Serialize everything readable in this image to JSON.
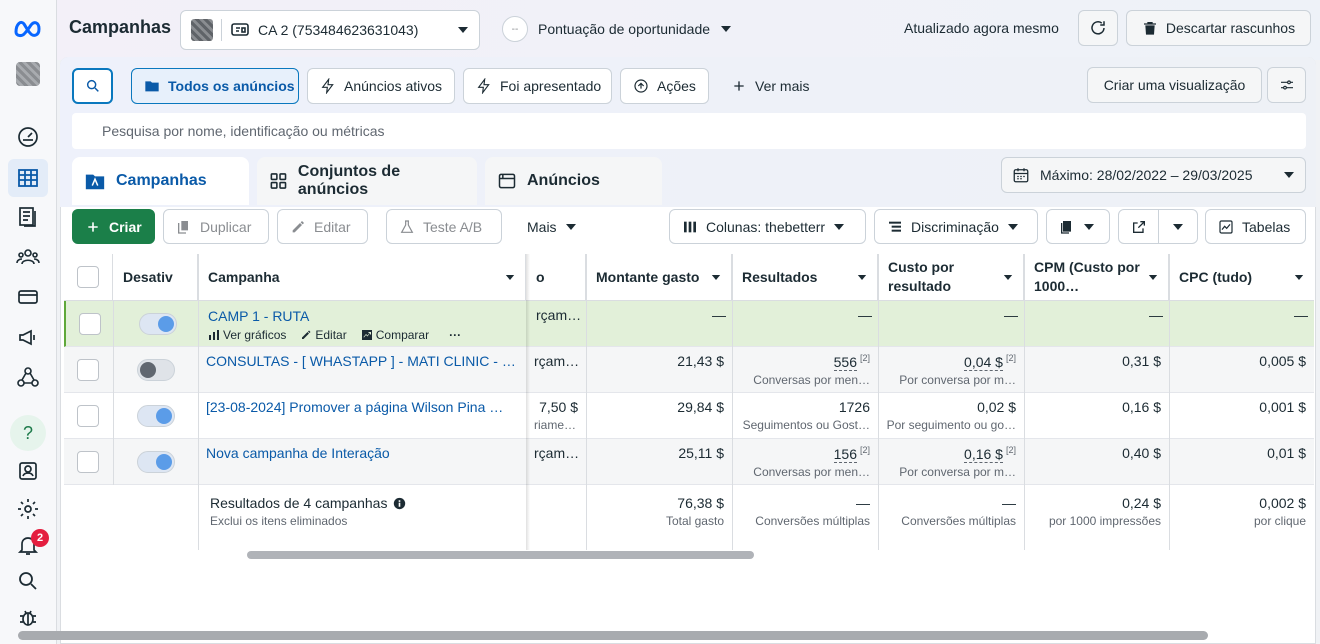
{
  "header": {
    "title": "Campanhas",
    "account_name": "CA 2 (753484623631043)",
    "opportunity_label": "Pontuação de oportunidade",
    "opportunity_dots": "--",
    "updated_label": "Atualizado agora mesmo",
    "discard_label": "Descartar rascunhos"
  },
  "rail": {
    "notification_count": "2",
    "help_glyph": "?"
  },
  "filters": {
    "all_ads": "Todos os anúncios",
    "active_ads": "Anúncios ativos",
    "presented": "Foi apresentado",
    "actions": "Ações",
    "see_more": "Ver mais",
    "create_view": "Criar uma visualização",
    "search_placeholder": "Pesquisa por nome, identificação ou métricas"
  },
  "tabs": [
    {
      "label": "Campanhas"
    },
    {
      "label": "Conjuntos de anúncios"
    },
    {
      "label": "Anúncios"
    }
  ],
  "date_range": "Máximo: 28/02/2022 – 29/03/2025",
  "toolbar": {
    "create": "Criar",
    "duplicate": "Duplicar",
    "edit": "Editar",
    "ab_test": "Teste A/B",
    "more": "Mais",
    "columns": "Colunas: thebetterr",
    "breakdown": "Discriminação",
    "tables": "Tabelas"
  },
  "table": {
    "headers": {
      "off": "Desativ",
      "campaign": "Campanha",
      "budget_partial": "o",
      "spent": "Montante gasto",
      "results": "Resultados",
      "cost_per_result": "Custo por resultado",
      "cpm": "CPM (Custo por 1000…",
      "cpc": "CPC (tudo)"
    },
    "row_actions": {
      "charts": "Ver gráficos",
      "edit": "Editar",
      "compare": "Comparar",
      "more": "···"
    },
    "rows": [
      {
        "name": "CAMP 1 - RUTA",
        "budget": "rçam…",
        "budget_sub": "",
        "spent": "—",
        "results": "—",
        "results_sub": "",
        "results_sup": "",
        "cpr": "—",
        "cpr_sub": "",
        "cpr_sup": "",
        "cpm": "—",
        "cpc": "—"
      },
      {
        "name": "CONSULTAS - [ WHASTAPP ] - MATI CLINIC - …",
        "budget": "rçam…",
        "budget_sub": "",
        "spent": "21,43 $",
        "results": "556",
        "results_sub": "Conversas por men…",
        "results_sup": "[2]",
        "cpr": "0,04 $",
        "cpr_sub": "Por conversa por m…",
        "cpr_sup": "[2]",
        "cpm": "0,31 $",
        "cpc": "0,005 $"
      },
      {
        "name": "[23-08-2024] Promover a página Wilson Pina …",
        "budget": "7,50 $",
        "budget_sub": "riamente",
        "spent": "29,84 $",
        "results": "1726",
        "results_sub": "Seguimentos ou Gost…",
        "results_sup": "",
        "cpr": "0,02 $",
        "cpr_sub": "Por seguimento ou go…",
        "cpr_sup": "",
        "cpm": "0,16 $",
        "cpc": "0,001 $"
      },
      {
        "name": "Nova campanha de Interação",
        "budget": "rçam…",
        "budget_sub": "",
        "spent": "25,11 $",
        "results": "156",
        "results_sub": "Conversas por men…",
        "results_sup": "[2]",
        "cpr": "0,16 $",
        "cpr_sub": "Por conversa por m…",
        "cpr_sup": "[2]",
        "cpm": "0,40 $",
        "cpc": "0,01 $"
      }
    ],
    "totals": {
      "title": "Resultados de 4 campanhas",
      "subtitle": "Exclui os itens eliminados",
      "spent": "76,38 $",
      "spent_sub": "Total gasto",
      "results": "—",
      "results_sub": "Conversões múltiplas",
      "cpr": "—",
      "cpr_sub": "Conversões múltiplas",
      "cpm": "0,24 $",
      "cpm_sub": "por 1000 impressões",
      "cpc": "0,002 $",
      "cpc_sub": "por clique"
    }
  }
}
